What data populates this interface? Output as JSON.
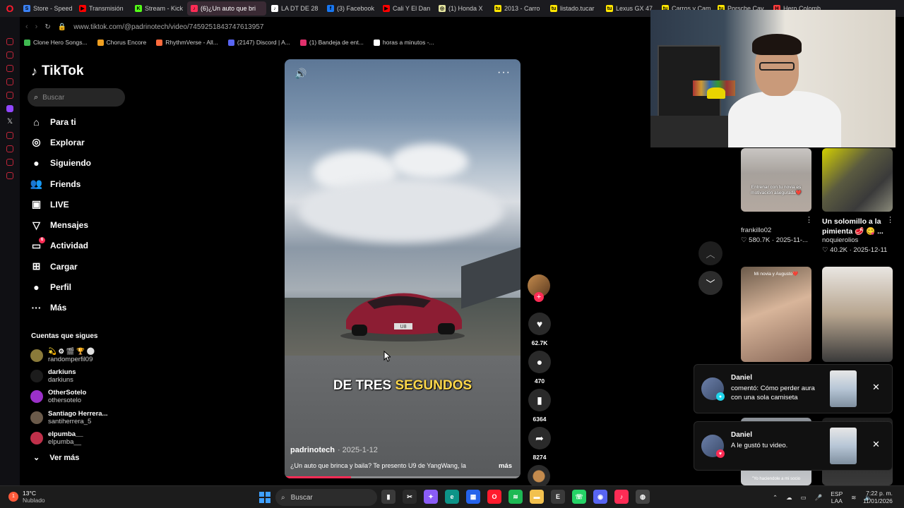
{
  "browser": {
    "tabs": [
      {
        "label": "Store - Speed",
        "color": "#3b82f6",
        "glyph": "S"
      },
      {
        "label": "Transmisión",
        "color": "#ff0000",
        "glyph": "▶"
      },
      {
        "label": "Stream - Kick",
        "color": "#53fc18",
        "glyph": "K"
      },
      {
        "label": "(6)¿Un auto que bri",
        "color": "#fe2c55",
        "glyph": "♪",
        "active": true
      },
      {
        "label": "LA DT DE 28",
        "color": "#ffffff",
        "glyph": "♪"
      },
      {
        "label": "(3) Facebook",
        "color": "#1877f2",
        "glyph": "f"
      },
      {
        "label": "Cali Y El Dan",
        "color": "#ff0000",
        "glyph": "▶"
      },
      {
        "label": "(1) Honda X",
        "color": "#e5e5a0",
        "glyph": "◎"
      },
      {
        "label": "2013 - Carro",
        "color": "#ffe600",
        "glyph": "tu"
      },
      {
        "label": "listado.tucar",
        "color": "#ffe600",
        "glyph": "tu"
      },
      {
        "label": "Lexus GX 47",
        "color": "#ffe600",
        "glyph": "tu"
      },
      {
        "label": "Carros y Cam",
        "color": "#ffe600",
        "glyph": "tu"
      },
      {
        "label": "Porsche Cay",
        "color": "#ffe600",
        "glyph": "tu"
      },
      {
        "label": "Hero Colomb",
        "color": "#ff3b3b",
        "glyph": "H"
      }
    ],
    "url": "www.tiktok.com/@padrinotech/video/7459251843747613957",
    "bookmarks": [
      {
        "label": "Clone Hero Songs...",
        "color": "#3fb950"
      },
      {
        "label": "Chorus Encore",
        "color": "#f0a020"
      },
      {
        "label": "RhythmVerse - All...",
        "color": "#ff6b3d"
      },
      {
        "label": "(2147) Discord | A...",
        "color": "#5865f2"
      },
      {
        "label": "(1) Bandeja de ent...",
        "color": "#e1306c"
      },
      {
        "label": "horas a minutos -...",
        "color": "#ffffff"
      }
    ]
  },
  "tiktok": {
    "logo": "TikTok",
    "search_placeholder": "Buscar",
    "nav": [
      {
        "label": "Para ti",
        "icon": "home-icon",
        "glyph": "⌂"
      },
      {
        "label": "Explorar",
        "icon": "compass-icon",
        "glyph": "◎"
      },
      {
        "label": "Siguiendo",
        "icon": "following-avatar-icon",
        "glyph": "●"
      },
      {
        "label": "Friends",
        "icon": "friends-icon",
        "glyph": "👥"
      },
      {
        "label": "LIVE",
        "icon": "live-icon",
        "glyph": "▣"
      },
      {
        "label": "Mensajes",
        "icon": "messages-icon",
        "glyph": "▽"
      },
      {
        "label": "Actividad",
        "icon": "activity-icon",
        "glyph": "▭",
        "badge": "6"
      },
      {
        "label": "Cargar",
        "icon": "upload-icon",
        "glyph": "⊞"
      },
      {
        "label": "Perfil",
        "icon": "profile-icon",
        "glyph": "●"
      },
      {
        "label": "Más",
        "icon": "more-icon",
        "glyph": "···"
      }
    ],
    "following_title": "Cuentas que sigues",
    "following": [
      {
        "name": "💫 ⚙ 🎬 🏆 ⚪",
        "handle": "randomperfil09",
        "color": "#8a7a3a"
      },
      {
        "name": "darkiuns",
        "handle": "darkiuns",
        "color": "#1c1c1c"
      },
      {
        "name": "OtherSotelo",
        "handle": "othersotelo",
        "color": "#9b30c9"
      },
      {
        "name": "Santiago Herrera...",
        "handle": "santiherrera_5",
        "color": "#6a5a4a"
      },
      {
        "name": "elpumba__",
        "handle": "elpumba__",
        "color": "#c0304a"
      }
    ],
    "see_more": "Ver más"
  },
  "video": {
    "caption_white": "DE TRES ",
    "caption_yellow": "SEGUNDOS",
    "author": "padrinotech",
    "date": "· 2025-1-12",
    "description": "¿Un auto que brinca y baila? Te presento U9 de YangWang, la",
    "more": "más",
    "progress": 0.28,
    "plate": "U8"
  },
  "actions": {
    "likes": "62.7K",
    "comments": "470",
    "saves": "6364",
    "shares": "8274"
  },
  "grid": {
    "card1_overlay": "Entrenar con tu novia es motivación asegurada❤️",
    "card1_author": "frankillo02",
    "card1_stats": "♡ 580.7K · 2025-11-...",
    "card2_title": "Un solomillo a la pimienta 🥩 😋 ...",
    "card2_author": "noquierolios",
    "card2_stats": "♡ 40.2K · 2025-12-11",
    "card3_overlay": "Mi novia y Augusto❤️",
    "card5_overlay": "\"Yo haciendole a mi socio"
  },
  "notifications": [
    {
      "who": "Daniel",
      "msg": "comentó: Cómo perder aura con una sola camiseta",
      "mini_color": "#20d5ec",
      "mini_glyph": "●"
    },
    {
      "who": "Daniel",
      "msg": "A le gustó tu video.",
      "mini_color": "#fe2c55",
      "mini_glyph": "♥"
    }
  ],
  "taskbar": {
    "temp": "13°C",
    "weather": "Nublado",
    "weather_badge": "1",
    "search": "Buscar",
    "lang_top": "ESP",
    "lang_bottom": "LAA",
    "time": "7:22 p. m.",
    "date": "11/01/2026",
    "apps": [
      {
        "name": "files-app-icon",
        "color": "#3a3a3a",
        "glyph": "▮"
      },
      {
        "name": "capcut-icon",
        "color": "#2a2a2a",
        "glyph": "✂"
      },
      {
        "name": "copilot-icon",
        "color": "#8a5cf6",
        "glyph": "✦"
      },
      {
        "name": "edge-icon",
        "color": "#0d9488",
        "glyph": "e"
      },
      {
        "name": "store-icon",
        "color": "#2563eb",
        "glyph": "▦"
      },
      {
        "name": "opera-icon",
        "color": "#ff1b2d",
        "glyph": "O"
      },
      {
        "name": "spotify-icon",
        "color": "#1db954",
        "glyph": "≋"
      },
      {
        "name": "folder-icon",
        "color": "#f2c14e",
        "glyph": "▬"
      },
      {
        "name": "epic-games-icon",
        "color": "#3a3a3a",
        "glyph": "E"
      },
      {
        "name": "whatsapp-icon",
        "color": "#25d366",
        "glyph": "☏"
      },
      {
        "name": "discord-icon",
        "color": "#5865f2",
        "glyph": "◉"
      },
      {
        "name": "tiktok-icon",
        "color": "#fe2c55",
        "glyph": "♪"
      },
      {
        "name": "obs-icon",
        "color": "#444444",
        "glyph": "◍"
      }
    ]
  }
}
